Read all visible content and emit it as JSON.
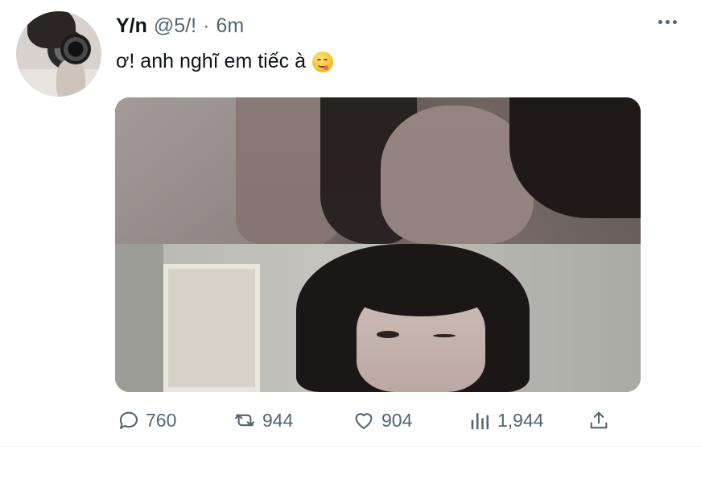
{
  "tweet": {
    "author": {
      "name": "Y/n",
      "handle": "@5/!",
      "separator": "·",
      "time": "6m"
    },
    "text": "ơ! anh nghĩ em tiếc à",
    "emoji_icon": "face-savoring-food-icon",
    "media": {
      "count": 2,
      "layout": "stacked"
    },
    "actions": {
      "replies": "760",
      "retweets": "944",
      "likes": "904",
      "views": "1,944"
    }
  },
  "colors": {
    "text_primary": "#0f1419",
    "text_secondary": "#536471",
    "divider": "#eff3f4"
  }
}
